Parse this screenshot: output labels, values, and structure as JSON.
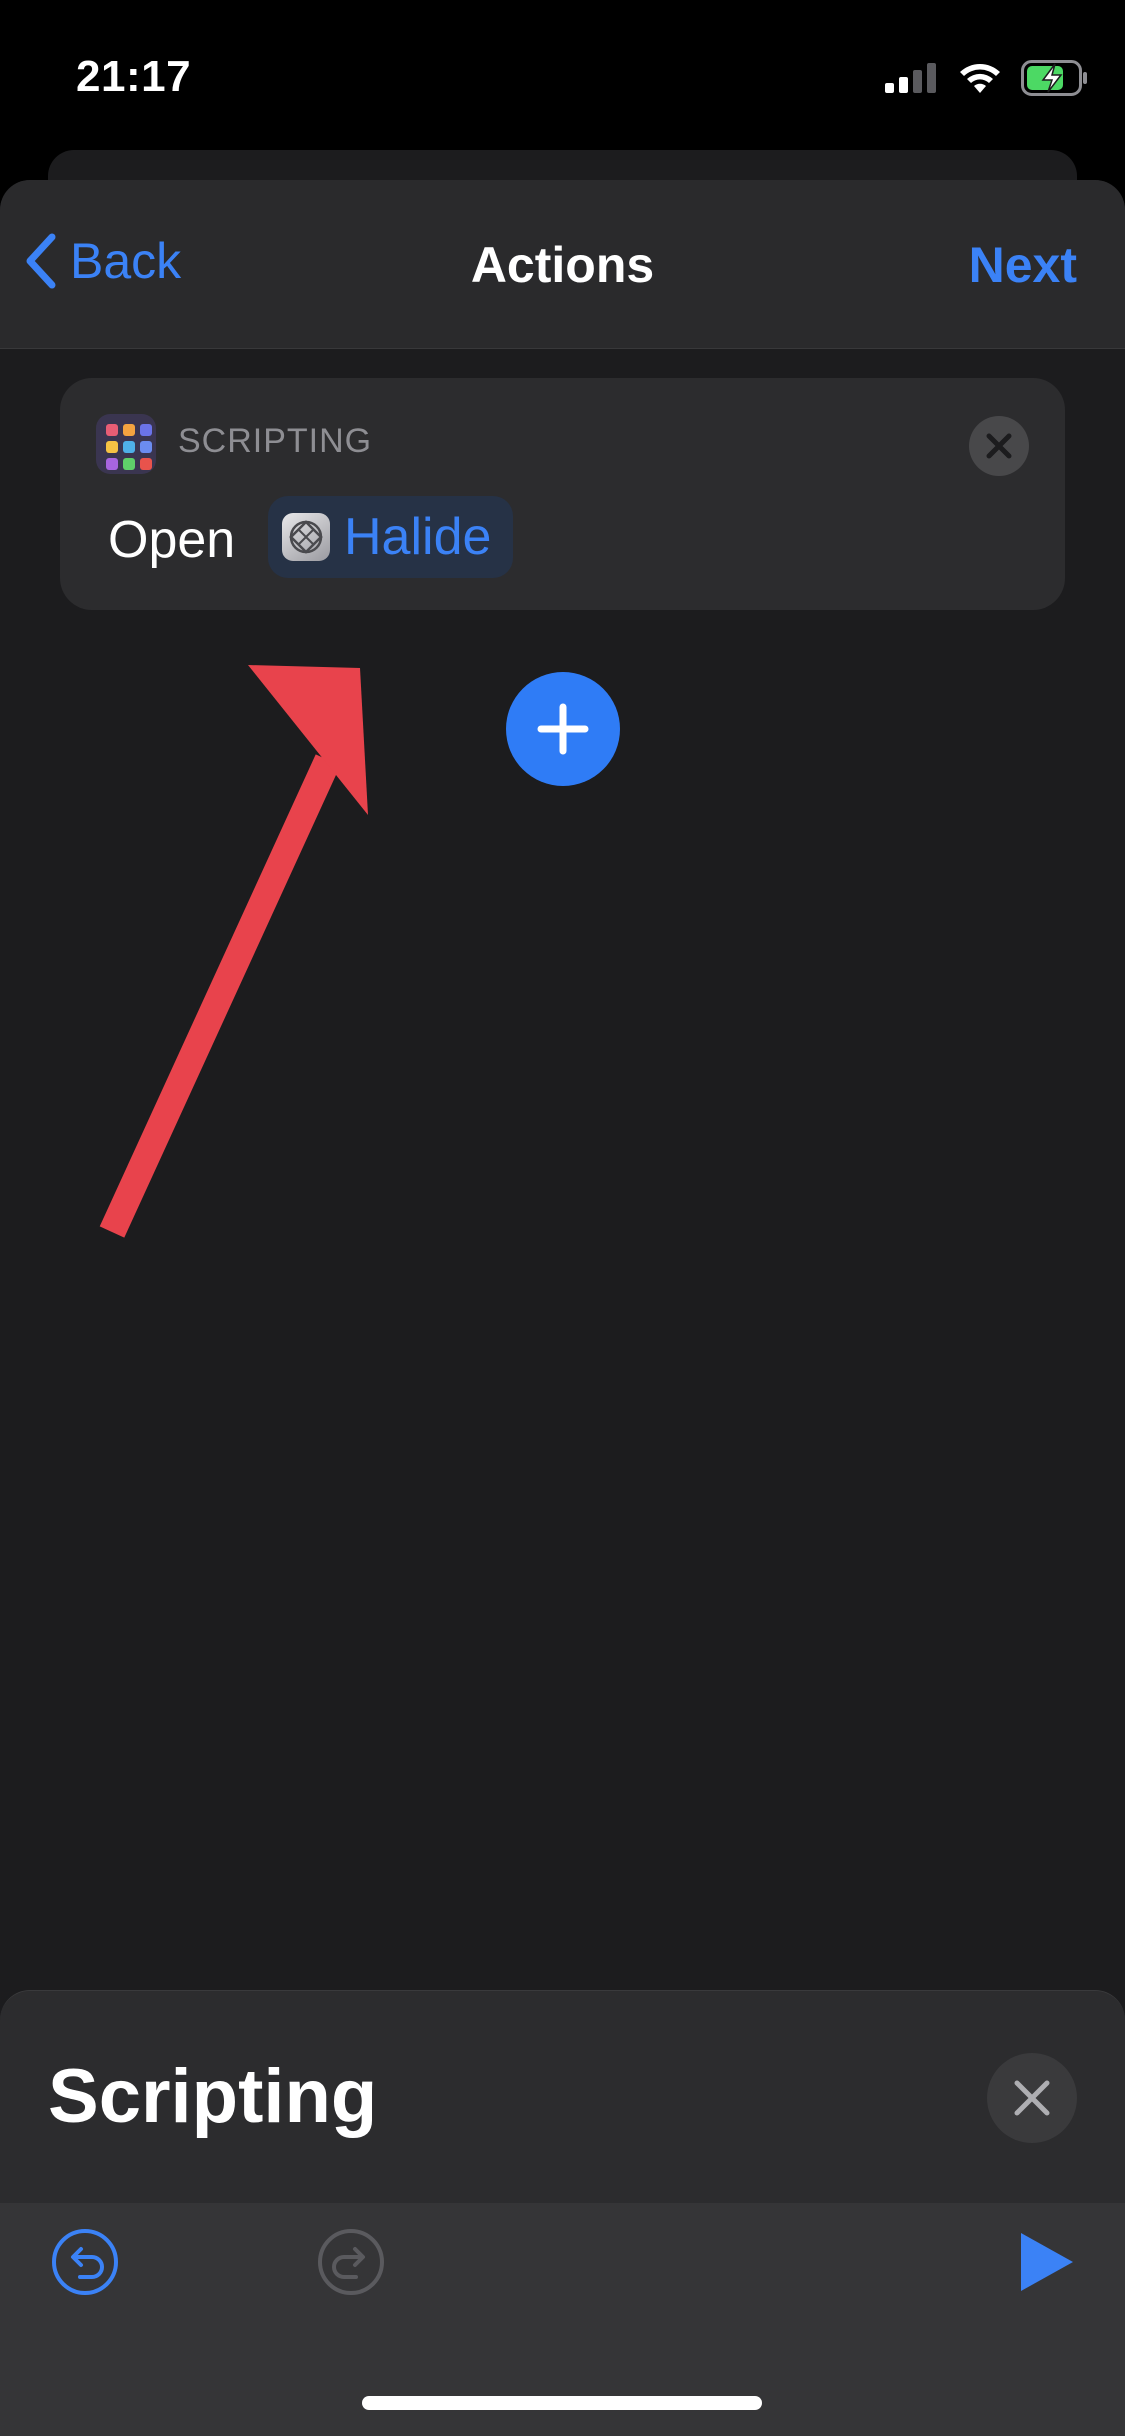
{
  "status_bar": {
    "time": "21:17",
    "icons": [
      "signal-icon",
      "wifi-icon",
      "battery-charging-icon"
    ]
  },
  "nav": {
    "back_label": "Back",
    "title": "Actions",
    "next_label": "Next"
  },
  "action": {
    "category": "SCRIPTING",
    "verb": "Open",
    "app_name": "Halide",
    "app_icon": "halide-app-icon"
  },
  "bottom_panel": {
    "title": "Scripting"
  },
  "toolbar": {
    "icons": [
      "undo-icon",
      "redo-icon",
      "play-icon"
    ]
  },
  "colors": {
    "accent": "#3b82f6",
    "add_button": "#2f7cf6",
    "annotation_arrow": "#e8434c",
    "background": "#1c1c1e"
  }
}
